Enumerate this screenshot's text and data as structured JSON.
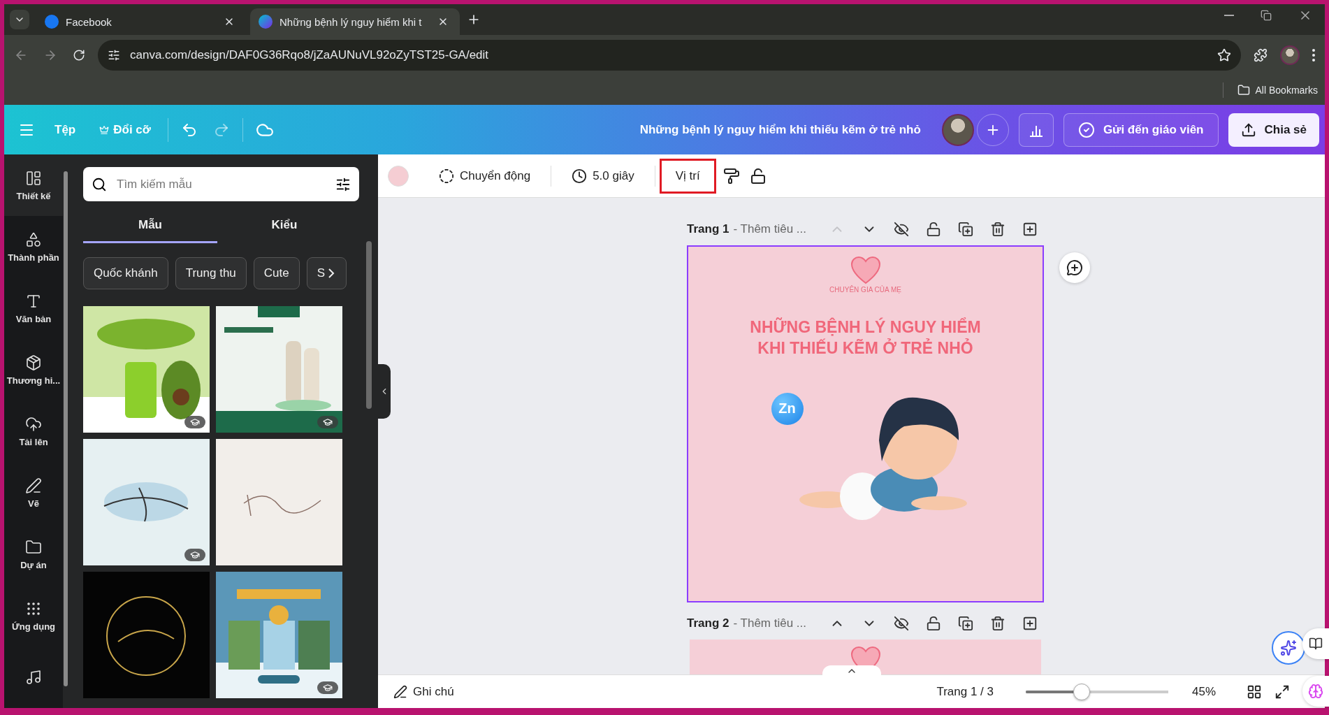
{
  "browser": {
    "tabs": [
      {
        "title": "Facebook",
        "selected": false
      },
      {
        "title": "Những bệnh lý nguy hiểm khi t",
        "selected": true
      }
    ],
    "url": "canva.com/design/DAF0G36Rqo8/jZaAUNuVL92oZyTST25-GA/edit",
    "bookmarks": "All Bookmarks"
  },
  "header": {
    "menu": [
      "Tệp",
      "Đổi cỡ"
    ],
    "title": "Những bệnh lý nguy hiểm khi thiếu kẽm ở trẻ nhỏ",
    "send_button": "Gửi đến giáo viên",
    "share_button": "Chia sẻ"
  },
  "toolbar": {
    "items": [
      {
        "kind": "motion",
        "label": "Chuyển động",
        "highlighted": false
      },
      {
        "kind": "timing",
        "label": "5.0 giây",
        "highlighted": false
      },
      {
        "kind": "text",
        "label": "Vị trí",
        "highlighted": true
      }
    ]
  },
  "rail": [
    {
      "kind": "design",
      "label": "Thiết kế",
      "selected": true
    },
    {
      "kind": "elements",
      "label": "Thành phần",
      "selected": false
    },
    {
      "kind": "text",
      "label": "Văn bản",
      "selected": false
    },
    {
      "kind": "brand",
      "label": "Thương hi...",
      "selected": false
    },
    {
      "kind": "upload",
      "label": "Tải lên",
      "selected": false
    },
    {
      "kind": "draw",
      "label": "Vẽ",
      "selected": false
    },
    {
      "kind": "projects",
      "label": "Dự án",
      "selected": false
    },
    {
      "kind": "apps",
      "label": "Ứng dụng",
      "selected": false
    },
    {
      "kind": "music",
      "selected": false
    }
  ],
  "panel": {
    "search": {
      "placeholder": "Tìm kiếm mẫu"
    },
    "tabs": [
      {
        "label": "Mẫu",
        "selected": true
      },
      {
        "label": "Kiểu",
        "selected": false
      }
    ],
    "chips": [
      "Quốc khánh",
      "Trung thu",
      "Cute",
      "S"
    ],
    "templates": [
      {
        "kind": "green",
        "premium": true
      },
      {
        "kind": "product",
        "premium": true
      },
      {
        "kind": "watercolor",
        "premium": true
      },
      {
        "kind": "beige",
        "premium": false
      },
      {
        "kind": "dark",
        "premium": false
      },
      {
        "kind": "travel",
        "premium": true
      }
    ]
  },
  "pages": [
    {
      "label": "Trang 1",
      "subtitle": "- Thêm tiêu ...",
      "up_disabled": true,
      "design": {
        "logo_caption": "CHUYÊN GIA CỦA MẸ",
        "headline": [
          "NHỮNG BỆNH LÝ NGUY HIỂM",
          "KHI THIẾU KẼM Ở TRẺ NHỎ"
        ],
        "badge": "Zn"
      }
    },
    {
      "label": "Trang 2",
      "subtitle": "- Thêm tiêu ...",
      "up_disabled": false
    }
  ],
  "footer": {
    "notes": "Ghi chú",
    "page_counter": "Trang 1 / 3",
    "zoom": {
      "level": 0.39,
      "reading": "45%"
    }
  }
}
